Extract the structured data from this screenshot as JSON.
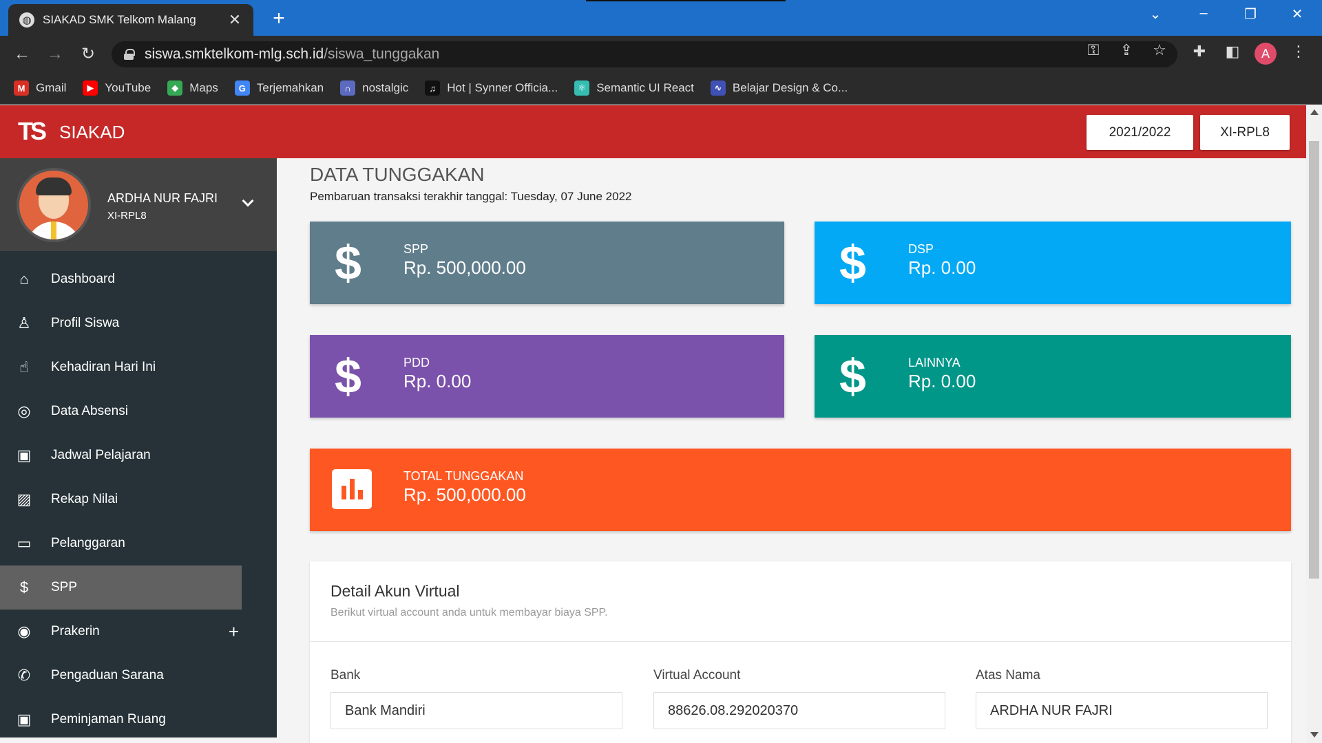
{
  "browser": {
    "tab_title": "SIAKAD SMK Telkom Malang",
    "url_host": "siswa.smktelkom-mlg.sch.id",
    "url_path": "/siswa_tunggakan",
    "profile_initial": "A",
    "bookmarks": [
      {
        "label": "Gmail",
        "color": "#d93025",
        "glyph": "M"
      },
      {
        "label": "YouTube",
        "color": "#ff0000",
        "glyph": "▶"
      },
      {
        "label": "Maps",
        "color": "#34a853",
        "glyph": "◆"
      },
      {
        "label": "Terjemahkan",
        "color": "#4285f4",
        "glyph": "G"
      },
      {
        "label": "nostalgic",
        "color": "#5c6bc0",
        "glyph": "∩"
      },
      {
        "label": "Hot | Synner Officia...",
        "color": "#111111",
        "glyph": "♫"
      },
      {
        "label": "Semantic UI React",
        "color": "#35bdb2",
        "glyph": "⚛"
      },
      {
        "label": "Belajar Design & Co...",
        "color": "#3f51b5",
        "glyph": "∿"
      }
    ]
  },
  "header": {
    "app_name": "SIAKAD",
    "logo_text": "TS",
    "year": "2021/2022",
    "class": "XI-RPL8",
    "brand_color": "#c62828"
  },
  "sidebar": {
    "user_name": "ARDHA NUR FAJRI",
    "user_class": "XI-RPL8",
    "items": [
      {
        "label": "Dashboard",
        "icon": "home-icon",
        "glyph": "⌂"
      },
      {
        "label": "Profil Siswa",
        "icon": "person-icon",
        "glyph": "♙"
      },
      {
        "label": "Kehadiran Hari Ini",
        "icon": "touch-icon",
        "glyph": "☝"
      },
      {
        "label": "Data Absensi",
        "icon": "fingerprint-icon",
        "glyph": "◎"
      },
      {
        "label": "Jadwal Pelajaran",
        "icon": "calendar-icon",
        "glyph": "▣"
      },
      {
        "label": "Rekap Nilai",
        "icon": "grade-icon",
        "glyph": "▨"
      },
      {
        "label": "Pelanggaran",
        "icon": "window-icon",
        "glyph": "▭"
      },
      {
        "label": "SPP",
        "icon": "dollar-icon",
        "glyph": "$"
      },
      {
        "label": "Prakerin",
        "icon": "compass-icon",
        "glyph": "◉"
      },
      {
        "label": "Pengaduan Sarana",
        "icon": "phone-icon",
        "glyph": "✆"
      },
      {
        "label": "Peminjaman Ruang",
        "icon": "calendar-icon",
        "glyph": "▣"
      }
    ]
  },
  "main": {
    "title": "DATA TUNGGAKAN",
    "subtitle": "Pembaruan transaksi terakhir tanggal: Tuesday, 07 June 2022",
    "cards": {
      "spp": {
        "label": "SPP",
        "value": "Rp. 500,000.00",
        "color": "#607d8b"
      },
      "dsp": {
        "label": "DSP",
        "value": "Rp. 0.00",
        "color": "#03a9f4"
      },
      "pdd": {
        "label": "PDD",
        "value": "Rp. 0.00",
        "color": "#7b52ab"
      },
      "lainnya": {
        "label": "LAINNYA",
        "value": "Rp. 0.00",
        "color": "#009688"
      },
      "total": {
        "label": "TOTAL TUNGGAKAN",
        "value": "Rp. 500,000.00",
        "color": "#ff5722"
      }
    },
    "detail": {
      "title": "Detail Akun Virtual",
      "description": "Berikut virtual account anda untuk membayar biaya SPP.",
      "bank_label": "Bank",
      "bank_value": "Bank Mandiri",
      "va_label": "Virtual Account",
      "va_value": "88626.08.292020370",
      "name_label": "Atas Nama",
      "name_value": "ARDHA NUR FAJRI"
    }
  }
}
